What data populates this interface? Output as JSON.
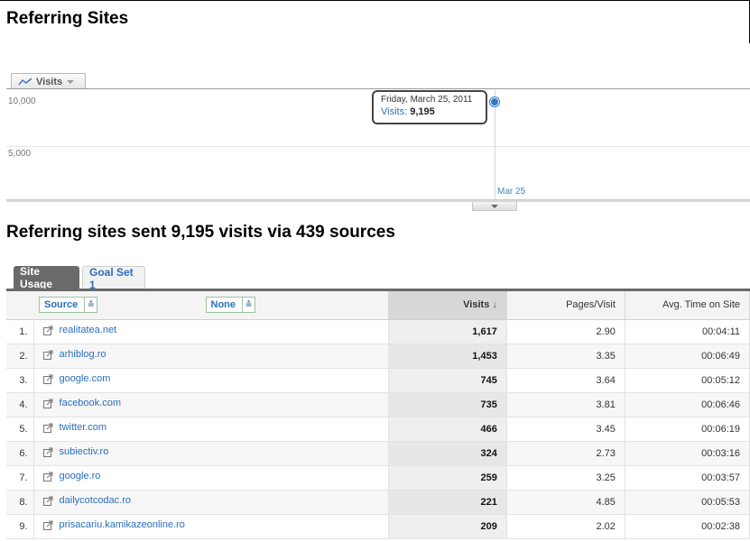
{
  "page": {
    "title": "Referring Sites"
  },
  "graph": {
    "metric_label": "Visits",
    "y_ticks": [
      "10,000",
      "5,000"
    ],
    "x_label": "Mar 25",
    "tooltip": {
      "date": "Friday, March 25, 2011",
      "metric": "Visits:",
      "value": "9,195"
    },
    "point_color": "#2f7ac8"
  },
  "summary": "Referring sites sent 9,195 visits via 439 sources",
  "tabs": [
    {
      "label": "Site Usage",
      "active": true
    },
    {
      "label": "Goal Set 1",
      "active": false
    }
  ],
  "table": {
    "dimension_label": "Source",
    "secondary_label": "None",
    "columns": {
      "visits": "Visits",
      "pages_visit": "Pages/Visit",
      "avg_time": "Avg. Time on Site"
    },
    "rows": [
      {
        "idx": "1.",
        "source": "realitatea.net",
        "visits": "1,617",
        "pages": "2.90",
        "time": "00:04:11"
      },
      {
        "idx": "2.",
        "source": "arhiblog.ro",
        "visits": "1,453",
        "pages": "3.35",
        "time": "00:06:49"
      },
      {
        "idx": "3.",
        "source": "google.com",
        "visits": "745",
        "pages": "3.64",
        "time": "00:05:12"
      },
      {
        "idx": "4.",
        "source": "facebook.com",
        "visits": "735",
        "pages": "3.81",
        "time": "00:06:46"
      },
      {
        "idx": "5.",
        "source": "twitter.com",
        "visits": "466",
        "pages": "3.45",
        "time": "00:06:19"
      },
      {
        "idx": "6.",
        "source": "subiectiv.ro",
        "visits": "324",
        "pages": "2.73",
        "time": "00:03:16"
      },
      {
        "idx": "7.",
        "source": "google.ro",
        "visits": "259",
        "pages": "3.25",
        "time": "00:03:57"
      },
      {
        "idx": "8.",
        "source": "dailycotcodac.ro",
        "visits": "221",
        "pages": "4.85",
        "time": "00:05:53"
      },
      {
        "idx": "9.",
        "source": "prisacariu.kamikazeonline.ro",
        "visits": "209",
        "pages": "2.02",
        "time": "00:02:38"
      }
    ]
  }
}
